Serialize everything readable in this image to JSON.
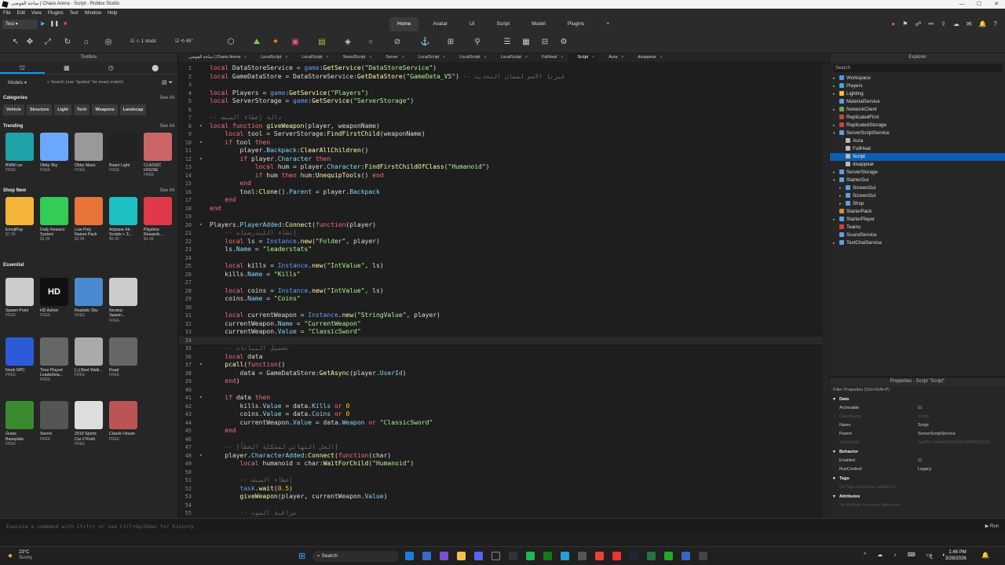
{
  "window": {
    "title": "ساحة الفوضى | Chaos Arena - Script - Roblox Studio",
    "controls": [
      "—",
      "☐",
      "✕"
    ]
  },
  "menu": [
    "File",
    "Edit",
    "View",
    "Plugins",
    "Test",
    "Window",
    "Help"
  ],
  "ribbon": {
    "mode": "Test",
    "tabs": [
      "Home",
      "Avatar",
      "UI",
      "Script",
      "Model",
      "Plugins"
    ],
    "add": "+",
    "active": "Home",
    "studs": "1 studs",
    "angle": "45°"
  },
  "toolbox": {
    "title": "Toolbox",
    "category": "Models",
    "search_placeholder": "Search (use \"quotes\" for exact match)",
    "categories_title": "Categories",
    "see_all": "See All",
    "chips": [
      "Vehicle",
      "Structure",
      "Light",
      "Tech",
      "Weapons",
      "Landscap"
    ],
    "trending_title": "Trending",
    "trending": [
      {
        "name": "BWM car",
        "price": "FREE",
        "color": "#1fa3a8"
      },
      {
        "name": "Obby Sky",
        "price": "FREE",
        "color": "#6aa8ff"
      },
      {
        "name": "Obby Maze",
        "price": "FREE",
        "color": "#999"
      },
      {
        "name": "Beam Light",
        "price": "FREE",
        "color": "#222"
      },
      {
        "name": "CLASSIC HOUSE",
        "price": "FREE",
        "color": "#c66"
      }
    ],
    "shop_title": "Shop New",
    "shop": [
      {
        "name": "EmojiPop",
        "price": "$7.99",
        "color": "#f5b43a"
      },
      {
        "name": "Daily Reward System",
        "price": "$2.99",
        "color": "#33cc55"
      },
      {
        "name": "Low Poly Nature Pack",
        "price": "$2.99",
        "color": "#e9743a"
      },
      {
        "name": "Airplane Kit - Scripts + 3...",
        "price": "$9.99",
        "color": "#1cc0c0"
      },
      {
        "name": "Playtime Rewards...",
        "price": "$4.99",
        "color": "#e03a4a"
      }
    ],
    "essential_title": "Essential",
    "essential1": [
      {
        "name": "Spawn Point",
        "price": "FREE",
        "color": "#ccc"
      },
      {
        "name": "HD Admin",
        "price": "FREE",
        "color": "#111"
      },
      {
        "name": "Realistic Sky",
        "price": "FREE",
        "color": "#4a8ad0"
      },
      {
        "name": "Neutral Spawn...",
        "price": "FREE",
        "color": "#ccc"
      }
    ],
    "hd_text": "HD",
    "essential2": [
      {
        "name": "Noob NPC",
        "price": "FREE",
        "color": "#2b5bd8"
      },
      {
        "name": "Time Played Leaderboa...",
        "price": "FREE",
        "color": "#666"
      },
      {
        "name": "[♫] Best Walk...",
        "price": "FREE",
        "color": "#aaa"
      },
      {
        "name": "Road",
        "price": "FREE",
        "color": "#666"
      }
    ],
    "essential3": [
      {
        "name": "Grass Baseplate",
        "price": "FREE",
        "color": "#3a8a30"
      },
      {
        "name": "Sword",
        "price": "FREE",
        "color": "#555"
      },
      {
        "name": "2019 Sports Car // Rosh",
        "price": "FREE",
        "color": "#ddd"
      },
      {
        "name": "Classic House",
        "price": "FREE",
        "color": "#b55"
      }
    ]
  },
  "tabs": [
    "ساحة الفوضى | Chaos Arena",
    "LocalScript",
    "LocalScript",
    "SwordScript",
    "Server",
    "LocalScript",
    "LocalScript",
    "LocalScript",
    "FullHeal",
    "Script",
    "Aura",
    "disappear"
  ],
  "active_tab": "Script",
  "code": [
    {
      "n": "1",
      "f": "",
      "h": "<span class='k'>local</span> DataStoreService = <span class='p'>game</span>:<span class='f'>GetService</span>(<span class='s'>\"DataStoreService\"</span>)"
    },
    {
      "n": "2",
      "f": "",
      "h": "<span class='k'>local</span> GameDataStore = DataStoreService:<span class='f'>GetDataStore</span>(<span class='s'>\"GameData_V5\"</span>) <span class='c'>-- غيرنا الاسم لضمان التحديث</span>"
    },
    {
      "n": "3",
      "f": "",
      "h": ""
    },
    {
      "n": "4",
      "f": "",
      "h": "<span class='k'>local</span> Players = <span class='p'>game</span>:<span class='f'>GetService</span>(<span class='s'>\"Players\"</span>)"
    },
    {
      "n": "5",
      "f": "",
      "h": "<span class='k'>local</span> ServerStorage = <span class='p'>game</span>:<span class='f'>GetService</span>(<span class='s'>\"ServerStorage\"</span>)"
    },
    {
      "n": "6",
      "f": "",
      "h": ""
    },
    {
      "n": "7",
      "f": "",
      "h": "<span class='c'>-- دالة إعطاء السيف</span>"
    },
    {
      "n": "8",
      "f": "▾",
      "h": "<span class='k'>local function</span> <span class='f'>giveWeapon</span>(player, weaponName)"
    },
    {
      "n": "9",
      "f": "",
      "h": "    <span class='k'>local</span> tool = ServerStorage:<span class='f'>FindFirstChild</span>(weaponName)"
    },
    {
      "n": "10",
      "f": "▾",
      "h": "    <span class='k'>if</span> tool <span class='k'>then</span>"
    },
    {
      "n": "11",
      "f": "",
      "h": "        player.<span class='b'>Backpack</span>:<span class='f'>ClearAllChildren</span>()"
    },
    {
      "n": "12",
      "f": "▾",
      "h": "        <span class='k'>if</span> player.<span class='b'>Character</span> <span class='k'>then</span>"
    },
    {
      "n": "13",
      "f": "",
      "h": "            <span class='k'>local</span> hum = player.<span class='b'>Character</span>:<span class='f'>FindFirstChildOfClass</span>(<span class='s'>\"Humanoid\"</span>)"
    },
    {
      "n": "14",
      "f": "",
      "h": "            <span class='k'>if</span> hum <span class='k'>then</span> hum:<span class='f'>UnequipTools</span>() <span class='k'>end</span>"
    },
    {
      "n": "15",
      "f": "",
      "h": "        <span class='k'>end</span>"
    },
    {
      "n": "16",
      "f": "",
      "h": "        tool:<span class='f'>Clone</span>().<span class='b'>Parent</span> = player.<span class='b'>Backpack</span>"
    },
    {
      "n": "17",
      "f": "",
      "h": "    <span class='k'>end</span>"
    },
    {
      "n": "18",
      "f": "",
      "h": "<span class='k'>end</span>"
    },
    {
      "n": "19",
      "f": "",
      "h": ""
    },
    {
      "n": "20",
      "f": "▾",
      "h": "Players.<span class='b'>PlayerAdded</span>:<span class='f'>Connect</span>(<span class='k'>function</span>(player)"
    },
    {
      "n": "21",
      "f": "",
      "h": "    <span class='c'>-- إنشاء الليدرستات</span>"
    },
    {
      "n": "22",
      "f": "",
      "h": "    <span class='k'>local</span> ls = <span class='p'>Instance</span>.<span class='f'>new</span>(<span class='s'>\"Folder\"</span>, player)"
    },
    {
      "n": "23",
      "f": "",
      "h": "    ls.<span class='b'>Name</span> = <span class='s'>\"leaderstats\"</span>"
    },
    {
      "n": "24",
      "f": "",
      "h": ""
    },
    {
      "n": "25",
      "f": "",
      "h": "    <span class='k'>local</span> kills = <span class='p'>Instance</span>.<span class='f'>new</span>(<span class='s'>\"IntValue\"</span>, ls)"
    },
    {
      "n": "26",
      "f": "",
      "h": "    kills.<span class='b'>Name</span> = <span class='s'>\"Kills\"</span>"
    },
    {
      "n": "27",
      "f": "",
      "h": ""
    },
    {
      "n": "28",
      "f": "",
      "h": "    <span class='k'>local</span> coins = <span class='p'>Instance</span>.<span class='f'>new</span>(<span class='s'>\"IntValue\"</span>, ls)"
    },
    {
      "n": "29",
      "f": "",
      "h": "    coins.<span class='b'>Name</span> = <span class='s'>\"Coins\"</span>"
    },
    {
      "n": "30",
      "f": "",
      "h": ""
    },
    {
      "n": "31",
      "f": "",
      "h": "    <span class='k'>local</span> currentWeapon = <span class='p'>Instance</span>.<span class='f'>new</span>(<span class='s'>\"StringValue\"</span>, player)"
    },
    {
      "n": "32",
      "f": "",
      "h": "    currentWeapon.<span class='b'>Name</span> = <span class='s'>\"CurrentWeapon\"</span>"
    },
    {
      "n": "33",
      "f": "",
      "h": "    currentWeapon.<span class='b'>Value</span> = <span class='s'>\"ClassicSword\"</span>"
    },
    {
      "n": "34",
      "f": "",
      "h": "",
      "cur": true
    },
    {
      "n": "35",
      "f": "",
      "h": "    <span class='c'>-- تحميل البيانات</span>"
    },
    {
      "n": "36",
      "f": "",
      "h": "    <span class='k'>local</span> data"
    },
    {
      "n": "37",
      "f": "▾",
      "h": "    <span class='f'>pcall</span>(<span class='k'>function</span>()"
    },
    {
      "n": "38",
      "f": "",
      "h": "        data = GameDataStore:<span class='f'>GetAsync</span>(player.<span class='b'>UserId</span>)"
    },
    {
      "n": "39",
      "f": "",
      "h": "    <span class='k'>end</span>)"
    },
    {
      "n": "40",
      "f": "",
      "h": ""
    },
    {
      "n": "41",
      "f": "▾",
      "h": "    <span class='k'>if</span> data <span class='k'>then</span>"
    },
    {
      "n": "42",
      "f": "",
      "h": "        kills.<span class='b'>Value</span> = data.<span class='b'>Kills</span> <span class='k'>or</span> <span class='n'>0</span>"
    },
    {
      "n": "43",
      "f": "",
      "h": "        coins.<span class='b'>Value</span> = data.<span class='b'>Coins</span> <span class='k'>or</span> <span class='n'>0</span>"
    },
    {
      "n": "44",
      "f": "",
      "h": "        currentWeapon.<span class='b'>Value</span> = data.<span class='b'>Weapon</span> <span class='k'>or</span> <span class='s'>\"ClassicSword\"</span>"
    },
    {
      "n": "45",
      "f": "",
      "h": "    <span class='k'>end</span>"
    },
    {
      "n": "46",
      "f": "",
      "h": ""
    },
    {
      "n": "47",
      "f": "",
      "h": "    <span class='c'>-- [الحل النهائي لمشكلة الخطأ]</span>"
    },
    {
      "n": "48",
      "f": "▾",
      "h": "    player.<span class='b'>CharacterAdded</span>:<span class='f'>Connect</span>(<span class='k'>function</span>(char)"
    },
    {
      "n": "49",
      "f": "",
      "h": "        <span class='k'>local</span> humanoid = char:<span class='f'>WaitForChild</span>(<span class='s'>\"Humanoid\"</span>)"
    },
    {
      "n": "50",
      "f": "",
      "h": ""
    },
    {
      "n": "51",
      "f": "",
      "h": "        <span class='c'>-- إعطاء السيف</span>"
    },
    {
      "n": "52",
      "f": "",
      "h": "        <span class='p'>task</span>.<span class='f'>wait</span>(<span class='n'>0.5</span>)"
    },
    {
      "n": "53",
      "f": "",
      "h": "        <span class='f'>giveWeapon</span>(player, currentWeapon.<span class='b'>Value</span>)"
    },
    {
      "n": "54",
      "f": "",
      "h": ""
    },
    {
      "n": "55",
      "f": "",
      "h": "        <span class='c'>-- مراقبة الموت</span>"
    }
  ],
  "explorer": {
    "title": "Explorer",
    "search": "Search",
    "nodes": [
      {
        "name": "Workspace",
        "indent": 0,
        "arrow": "▸",
        "color": "#4a9ae0"
      },
      {
        "name": "Players",
        "indent": 0,
        "arrow": "▸",
        "color": "#4aa0e0"
      },
      {
        "name": "Lighting",
        "indent": 0,
        "arrow": "▸",
        "color": "#f0c040"
      },
      {
        "name": "MaterialService",
        "indent": 0,
        "arrow": "",
        "color": "#5fa0e0"
      },
      {
        "name": "NetworkClient",
        "indent": 0,
        "arrow": "▸",
        "color": "#70a060"
      },
      {
        "name": "ReplicatedFirst",
        "indent": 0,
        "arrow": "",
        "color": "#d04040"
      },
      {
        "name": "ReplicatedStorage",
        "indent": 0,
        "arrow": "▸",
        "color": "#d04040"
      },
      {
        "name": "ServerScriptService",
        "indent": 0,
        "arrow": "▾",
        "color": "#5fa0e0"
      },
      {
        "name": "Aura",
        "indent": 1,
        "arrow": "",
        "color": "#bbb"
      },
      {
        "name": "FullHeal",
        "indent": 1,
        "arrow": "",
        "color": "#bbb"
      },
      {
        "name": "Script",
        "indent": 1,
        "arrow": "",
        "color": "#bbb",
        "sel": true
      },
      {
        "name": "disappear",
        "indent": 1,
        "arrow": "",
        "color": "#bbb"
      },
      {
        "name": "ServerStorage",
        "indent": 0,
        "arrow": "▸",
        "color": "#5fa0e0"
      },
      {
        "name": "StarterGui",
        "indent": 0,
        "arrow": "▾",
        "color": "#5fa0e0"
      },
      {
        "name": "ScreenGui",
        "indent": 1,
        "arrow": "▸",
        "color": "#5fa0e0"
      },
      {
        "name": "ScreenGui",
        "indent": 1,
        "arrow": "▸",
        "color": "#5fa0e0"
      },
      {
        "name": "Shop",
        "indent": 1,
        "arrow": "▸",
        "color": "#5fa0e0"
      },
      {
        "name": "StarterPack",
        "indent": 0,
        "arrow": "",
        "color": "#d09040"
      },
      {
        "name": "StarterPlayer",
        "indent": 0,
        "arrow": "▸",
        "color": "#5fa0e0"
      },
      {
        "name": "Teams",
        "indent": 0,
        "arrow": "",
        "color": "#d04040"
      },
      {
        "name": "SoundService",
        "indent": 0,
        "arrow": "",
        "color": "#5fa0e0"
      },
      {
        "name": "TextChatService",
        "indent": 0,
        "arrow": "▸",
        "color": "#5fa0e0"
      }
    ]
  },
  "properties": {
    "title": "Properties - Script \"Script\"",
    "filter": "Filter Properties (Ctrl+Shift+P)",
    "groups": [
      {
        "name": "Data",
        "rows": [
          {
            "k": "Archivable",
            "v": "☑",
            "dim": false
          },
          {
            "k": "ClassName",
            "v": "Script",
            "dim": true
          },
          {
            "k": "Name",
            "v": "Script",
            "dim": false
          },
          {
            "k": "Parent",
            "v": "ServerScriptService",
            "dim": false
          },
          {
            "k": "ScriptGuid",
            "v": "{aaf5b7a9a6ab6669b5814289891229}",
            "dim": true
          }
        ]
      },
      {
        "name": "Behavior",
        "rows": [
          {
            "k": "Enabled",
            "v": "☑",
            "dim": false
          },
          {
            "k": "RunContext",
            "v": "Legacy",
            "dim": false
          }
        ]
      },
      {
        "name": "Tags",
        "rows": [
          {
            "k": "No Tags have been added yet",
            "v": "",
            "dim": true
          }
        ]
      },
      {
        "name": "Attributes",
        "rows": [
          {
            "k": "No Attribute has been added yet",
            "v": "",
            "dim": true
          }
        ]
      }
    ]
  },
  "command": {
    "placeholder": "Execute a command with Ctrl+/ or use Ctrl+Up/Down for history",
    "run": "Run"
  },
  "taskbar": {
    "temp": "23°C",
    "weather": "Sunny",
    "search": "Search",
    "time": "1:46 PM",
    "date": "3/28/2026",
    "lang": "ع"
  }
}
